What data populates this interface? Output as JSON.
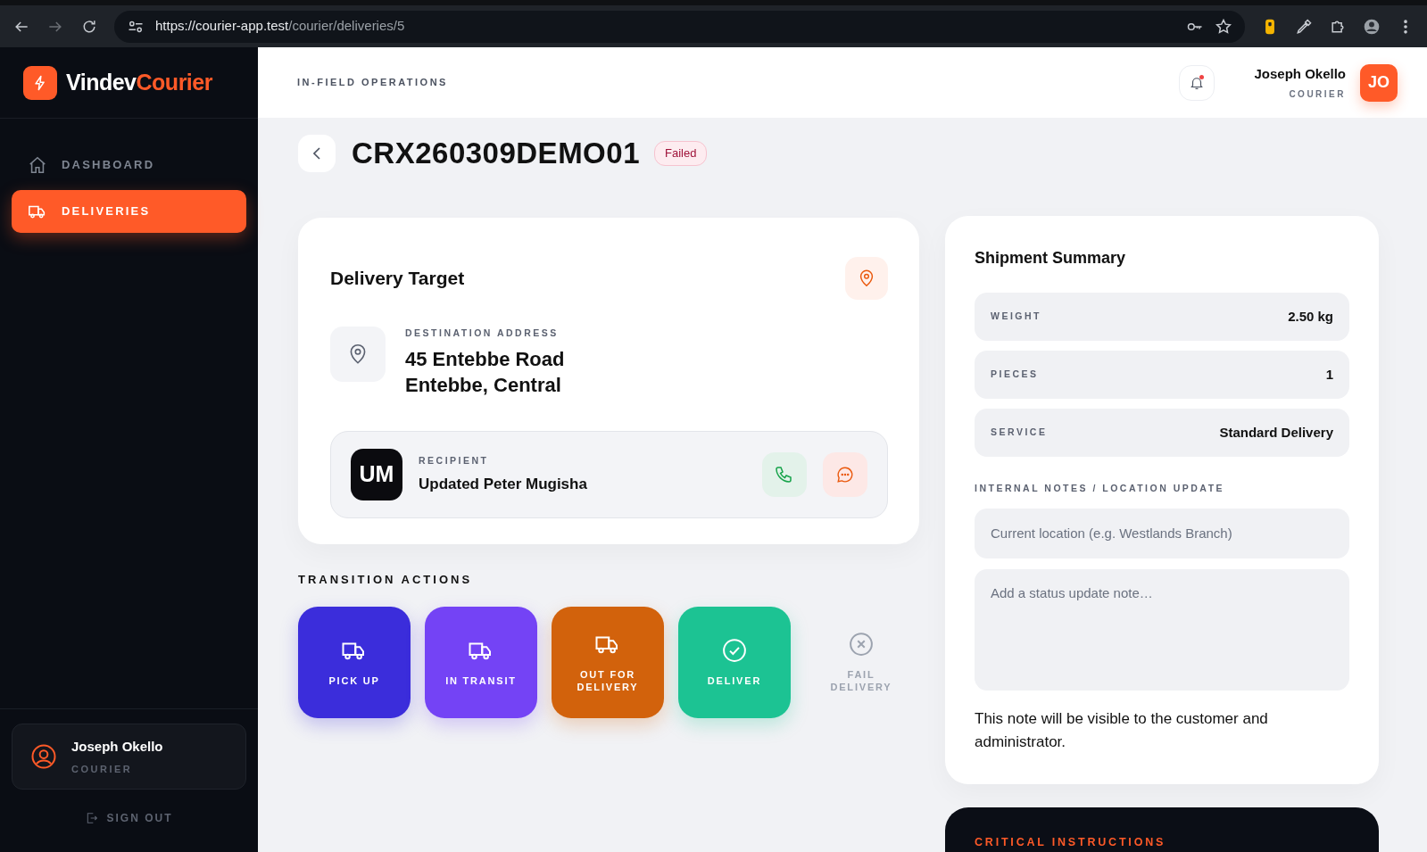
{
  "browser": {
    "url_host": "https://courier-app.test",
    "url_path": "/courier/deliveries/5"
  },
  "brand": {
    "first": "Vindev",
    "second": "Courier"
  },
  "sidebar": {
    "items": [
      {
        "label": "DASHBOARD",
        "kind": "home",
        "selected": false
      },
      {
        "label": "DELIVERIES",
        "kind": "truck",
        "selected": true
      }
    ],
    "user": {
      "name": "Joseph Okello",
      "role": "COURIER"
    },
    "sign_out": "SIGN OUT"
  },
  "header": {
    "section": "IN-FIELD OPERATIONS",
    "notifications_unread": true,
    "user": {
      "name": "Joseph Okello",
      "role": "COURIER",
      "initials": "JO"
    }
  },
  "delivery": {
    "code": "CRX260309DEMO01",
    "status": "Failed"
  },
  "target": {
    "title": "Delivery Target",
    "address_label": "DESTINATION ADDRESS",
    "address_lines": [
      "45 Entebbe Road",
      "Entebbe, Central"
    ],
    "recipient_label": "RECIPIENT",
    "recipient_initials": "UM",
    "recipient_name": "Updated Peter Mugisha"
  },
  "actions": {
    "title": "TRANSITION ACTIONS",
    "items": [
      {
        "label": "PICK UP",
        "kind": "truck",
        "color": "#3b2ddb",
        "disabled": false
      },
      {
        "label": "IN TRANSIT",
        "kind": "truck",
        "color": "#7443f5",
        "disabled": false
      },
      {
        "label": "OUT FOR DELIVERY",
        "kind": "truck",
        "color": "#d2620c",
        "disabled": false
      },
      {
        "label": "DELIVER",
        "kind": "check",
        "color": "#1cc393",
        "disabled": false
      },
      {
        "label": "FAIL DELIVERY",
        "kind": "x",
        "color": "#9ca3af",
        "disabled": true
      }
    ]
  },
  "summary": {
    "title": "Shipment Summary",
    "rows": [
      {
        "label": "WEIGHT",
        "value": "2.50 kg"
      },
      {
        "label": "PIECES",
        "value": "1"
      },
      {
        "label": "SERVICE",
        "value": "Standard Delivery"
      }
    ],
    "notes_label": "INTERNAL NOTES / LOCATION UPDATE",
    "location_placeholder": "Current location (e.g. Westlands Branch)",
    "note_placeholder": "Add a status update note…",
    "hint": "This note will be visible to the customer and administrator."
  },
  "critical": {
    "title": "CRITICAL INSTRUCTIONS"
  }
}
